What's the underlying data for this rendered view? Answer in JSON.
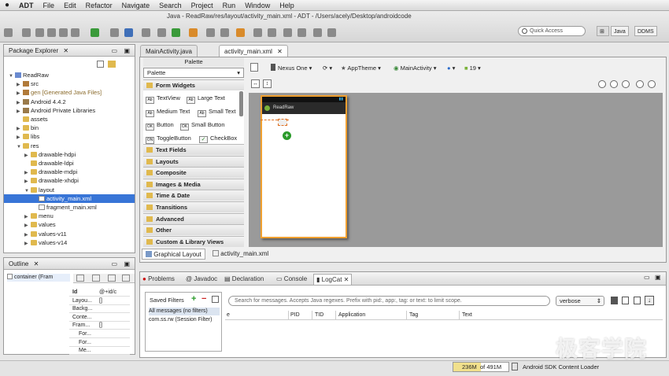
{
  "menubar": {
    "app": "ADT",
    "items": [
      "File",
      "Edit",
      "Refactor",
      "Navigate",
      "Search",
      "Project",
      "Run",
      "Window",
      "Help"
    ],
    "title": "Java - ReadRaw/res/layout/activity_main.xml - ADT - /Users/acely/Desktop/androidcode"
  },
  "toolbar": {
    "quick_access_placeholder": "Quick Access",
    "perspective_java": "Java",
    "perspective_ddms": "DDMS"
  },
  "package_explorer": {
    "title": "Package Explorer",
    "tree": [
      {
        "label": "ReadRaw",
        "indent": 0,
        "twisty": "▼",
        "icon": "proj"
      },
      {
        "label": "src",
        "indent": 1,
        "twisty": "▶",
        "icon": "pkg"
      },
      {
        "label": "gen [Generated Java Files]",
        "indent": 1,
        "twisty": "▶",
        "icon": "pkg"
      },
      {
        "label": "Android 4.4.2",
        "indent": 1,
        "twisty": "▶",
        "icon": "lib"
      },
      {
        "label": "Android Private Libraries",
        "indent": 1,
        "twisty": "▶",
        "icon": "lib"
      },
      {
        "label": "assets",
        "indent": 1,
        "twisty": "",
        "icon": "fold"
      },
      {
        "label": "bin",
        "indent": 1,
        "twisty": "▶",
        "icon": "fold"
      },
      {
        "label": "libs",
        "indent": 1,
        "twisty": "▶",
        "icon": "fold"
      },
      {
        "label": "res",
        "indent": 1,
        "twisty": "▼",
        "icon": "fold"
      },
      {
        "label": "drawable-hdpi",
        "indent": 2,
        "twisty": "▶",
        "icon": "fold"
      },
      {
        "label": "drawable-ldpi",
        "indent": 2,
        "twisty": "",
        "icon": "fold"
      },
      {
        "label": "drawable-mdpi",
        "indent": 2,
        "twisty": "▶",
        "icon": "fold"
      },
      {
        "label": "drawable-xhdpi",
        "indent": 2,
        "twisty": "▶",
        "icon": "fold"
      },
      {
        "label": "layout",
        "indent": 2,
        "twisty": "▼",
        "icon": "fold"
      },
      {
        "label": "activity_main.xml",
        "indent": 3,
        "twisty": "",
        "icon": "xml",
        "selected": true
      },
      {
        "label": "fragment_main.xml",
        "indent": 3,
        "twisty": "",
        "icon": "xml"
      },
      {
        "label": "menu",
        "indent": 2,
        "twisty": "▶",
        "icon": "fold"
      },
      {
        "label": "values",
        "indent": 2,
        "twisty": "▶",
        "icon": "fold"
      },
      {
        "label": "values-v11",
        "indent": 2,
        "twisty": "▶",
        "icon": "fold"
      },
      {
        "label": "values-v14",
        "indent": 2,
        "twisty": "▶",
        "icon": "fold"
      }
    ]
  },
  "outline": {
    "title": "Outline",
    "root": "container (Fram",
    "props": [
      {
        "name": "Id",
        "value": "@+id/c"
      },
      {
        "name": "Layou...",
        "value": "[]"
      },
      {
        "name": "Backg...",
        "value": ""
      },
      {
        "name": "Conte...",
        "value": ""
      },
      {
        "name": "Fram...",
        "value": "[]"
      },
      {
        "name": "For...",
        "value": ""
      },
      {
        "name": "For...",
        "value": ""
      },
      {
        "name": "Me...",
        "value": ""
      }
    ]
  },
  "editor": {
    "tabs": [
      "MainActivity.java",
      "activity_main.xml"
    ],
    "palette_title": "Palette",
    "palette_dropdown": "Palette",
    "form_widgets": "Form Widgets",
    "widgets": [
      {
        "icon": "Ab",
        "label": "TextView"
      },
      {
        "icon": "Ab",
        "label": "Large Text"
      },
      {
        "icon": "Ab",
        "label": "Medium Text"
      },
      {
        "icon": "Ab",
        "label": "Small Text"
      },
      {
        "icon": "OK",
        "label": "Button"
      },
      {
        "icon": "OK",
        "label": "Small Button"
      },
      {
        "icon": "ON",
        "label": "ToggleButton"
      },
      {
        "icon": "✓",
        "label": "CheckBox"
      }
    ],
    "categories": [
      "Text Fields",
      "Layouts",
      "Composite",
      "Images & Media",
      "Time & Date",
      "Transitions",
      "Advanced",
      "Other",
      "Custom & Library Views"
    ],
    "config": {
      "device": "Nexus One",
      "theme": "AppTheme",
      "activity": "MainActivity",
      "api": "19"
    },
    "device_app_title": "ReadRaw",
    "bottom_tabs": [
      "Graphical Layout",
      "activity_main.xml"
    ]
  },
  "bottom_panel": {
    "tabs": [
      "Problems",
      "Javadoc",
      "Declaration",
      "Console",
      "LogCat"
    ],
    "saved_filters_title": "Saved Filters",
    "filters": [
      "All messages (no filters)",
      "com.ss.rw (Session Filter)"
    ],
    "search_placeholder": "Search for messages. Accepts Java regexes. Prefix with pid:, app:, tag: or text: to limit scope.",
    "level": "verbose",
    "columns": [
      "e",
      "PID",
      "TID",
      "Application",
      "Tag",
      "Text"
    ]
  },
  "statusbar": {
    "heap_used": "236M",
    "heap_of": "of 491M",
    "loader": "Android SDK Content Loader"
  },
  "watermark": "极客学院"
}
